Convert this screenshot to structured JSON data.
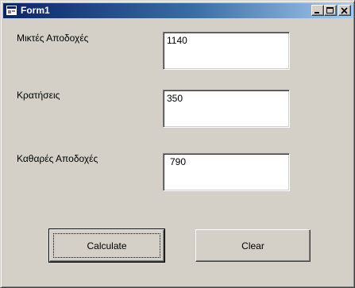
{
  "window": {
    "title": "Form1"
  },
  "form": {
    "gross_label": "Μικτές Αποδοχές",
    "gross_value": "1140",
    "deductions_label": "Κρατήσεις",
    "deductions_value": "350",
    "net_label": "Καθαρές Αποδοχές",
    "net_value": "790"
  },
  "buttons": {
    "calculate_label": "Calculate",
    "clear_label": "Clear"
  }
}
